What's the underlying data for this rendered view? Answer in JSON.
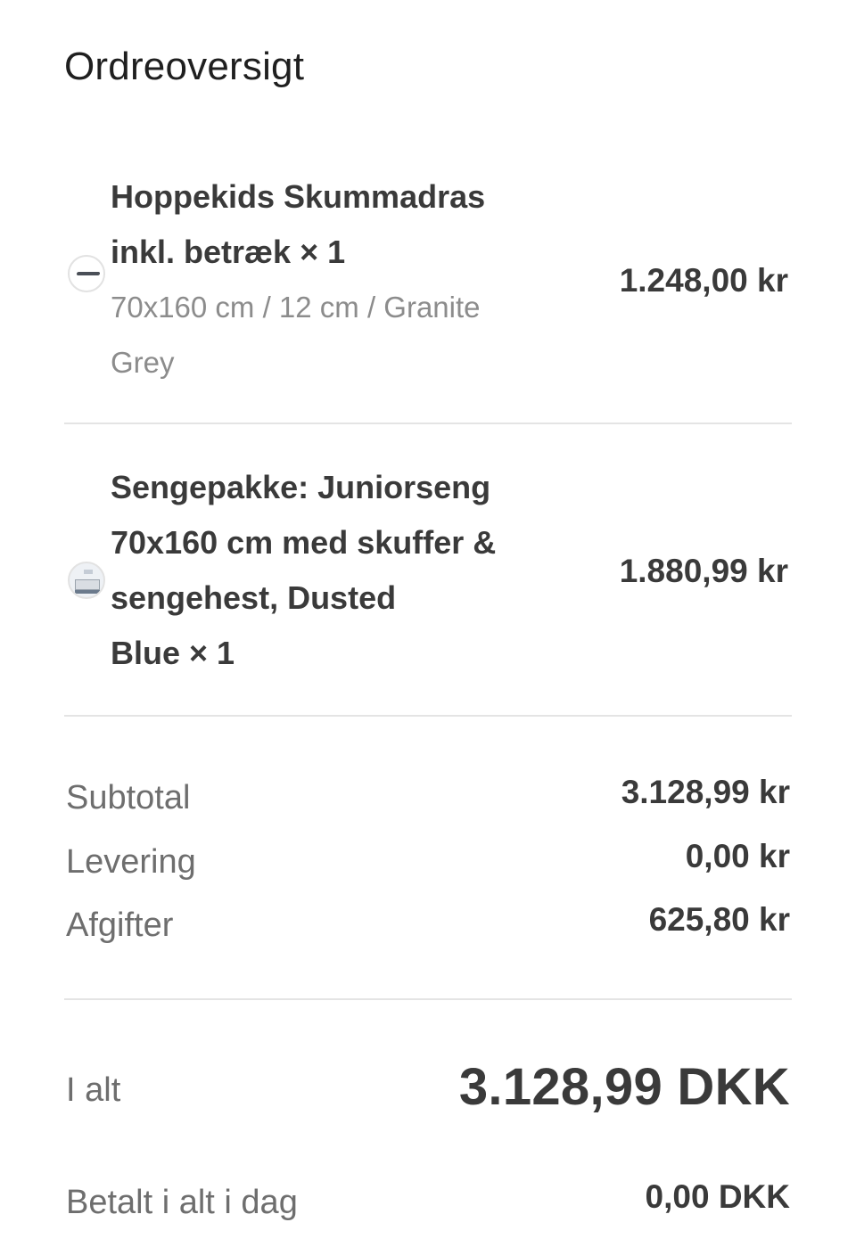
{
  "summary": {
    "title": "Ordreoversigt"
  },
  "items": [
    {
      "name_line1": "Hoppekids Skummadras",
      "name_line2": "inkl. betræk × 1",
      "variant_line1": "70x160 cm / 12 cm / Granite",
      "variant_line2": "Grey",
      "price": "1.248,00 kr",
      "thumbnail": "mattress-thumbnail"
    },
    {
      "name_line1": "Sengepakke: Juniorseng",
      "name_line2": "70x160 cm med skuffer &",
      "name_line3": "sengehest, Dusted",
      "name_line4": "Blue × 1",
      "price": "1.880,99 kr",
      "thumbnail": "bed-thumbnail"
    }
  ],
  "totals": {
    "subtotal_label": "Subtotal",
    "subtotal_value": "3.128,99 kr",
    "shipping_label": "Levering",
    "shipping_value": "0,00 kr",
    "taxes_label": "Afgifter",
    "taxes_value": "625,80 kr",
    "total_label": "I alt",
    "total_value": "3.128,99 DKK",
    "paid_label": "Betalt i alt i dag",
    "paid_value": "0,00 DKK"
  },
  "colors": {
    "text_primary": "#3a3a3a",
    "text_secondary": "#8c8c8c",
    "divider": "#e4e4e4",
    "background": "#ffffff"
  }
}
